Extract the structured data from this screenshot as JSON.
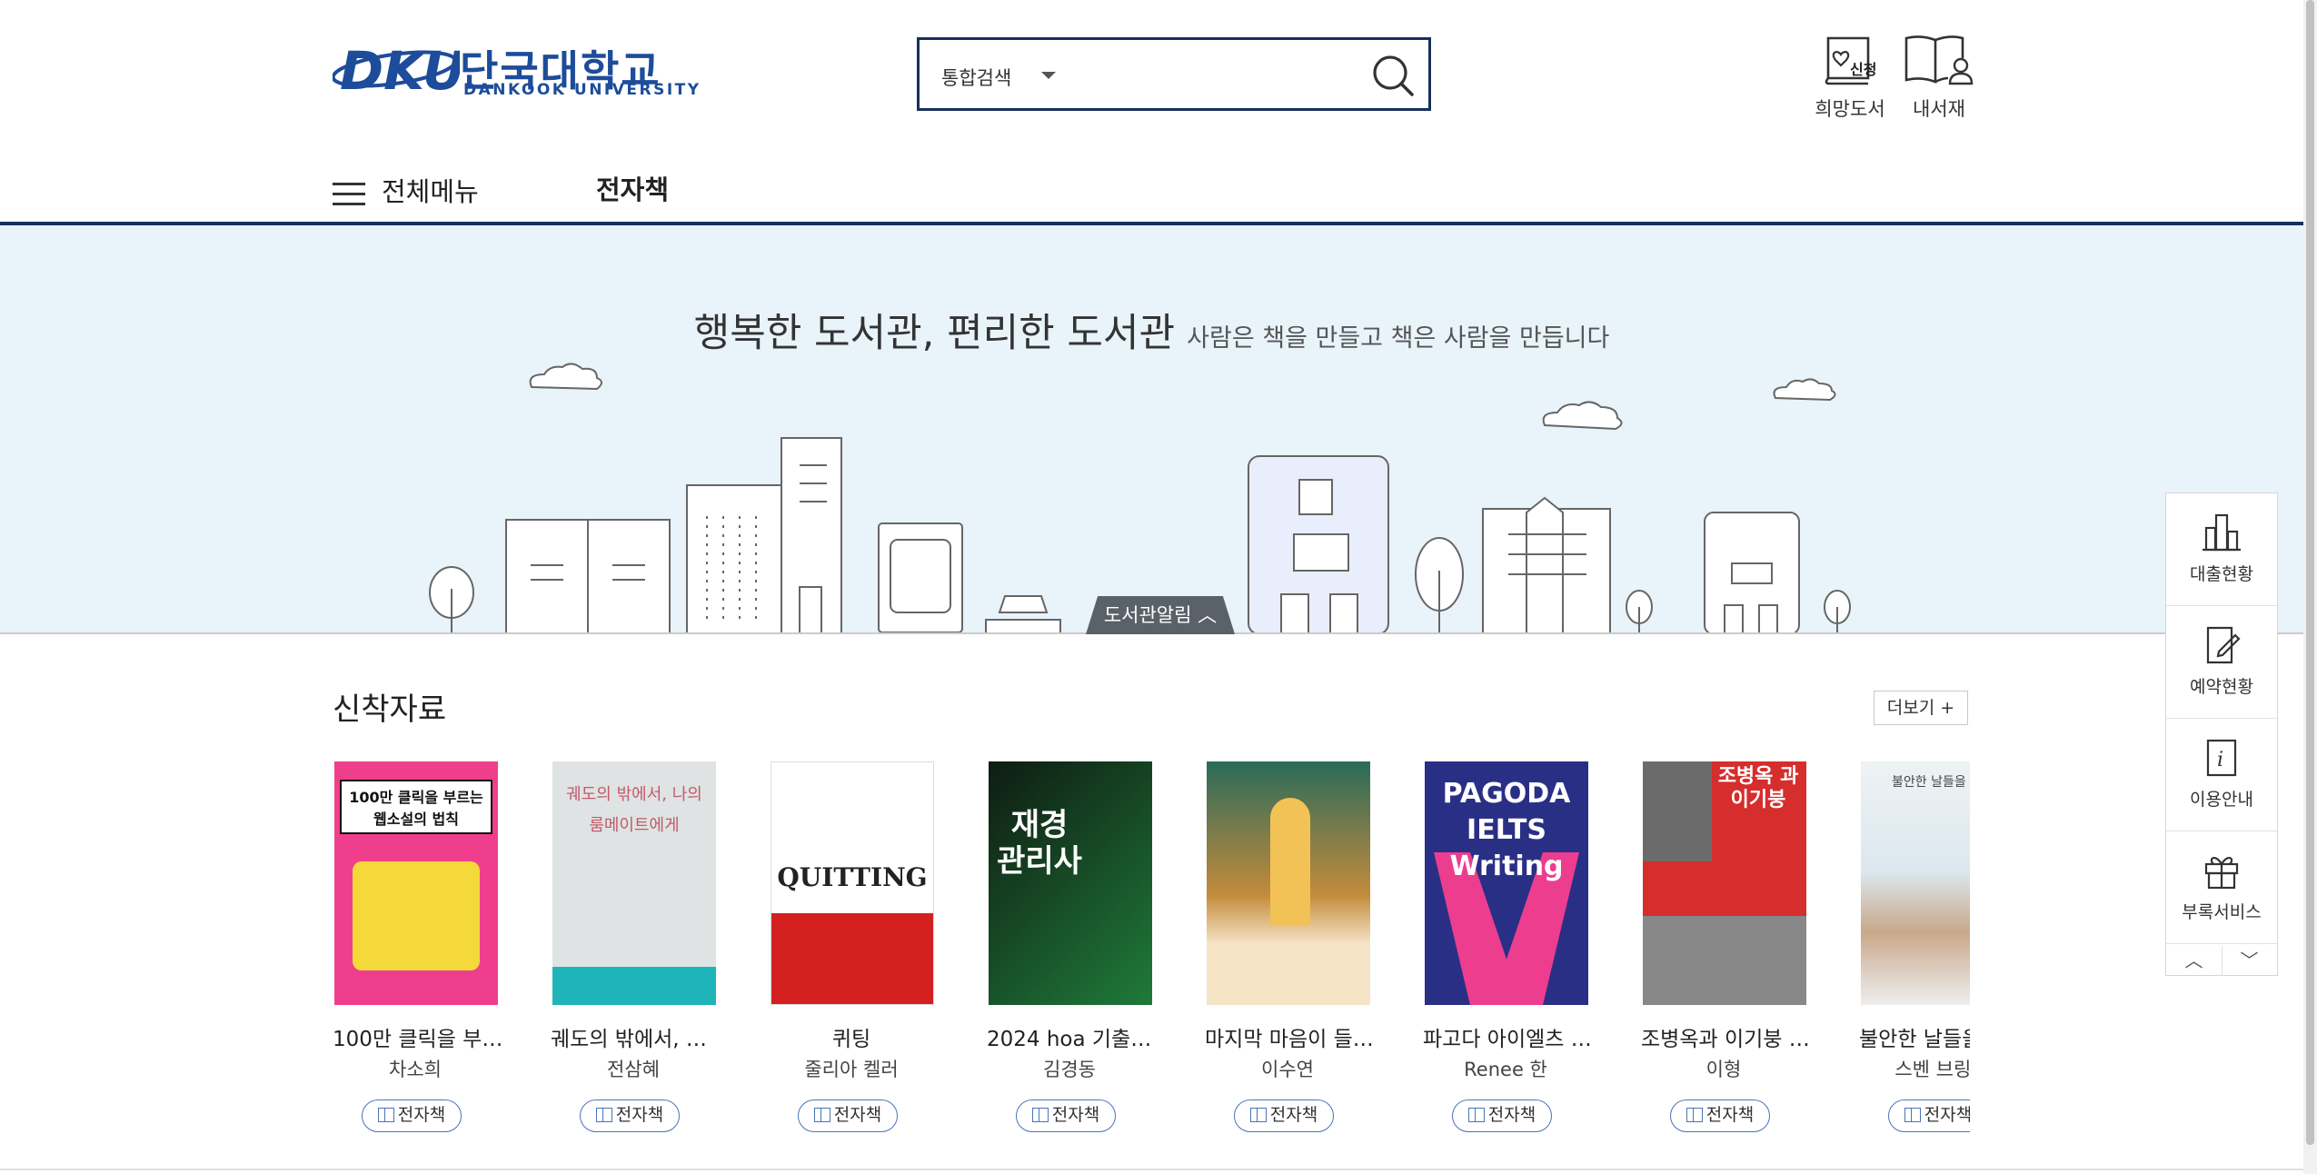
{
  "header": {
    "logo_mark": "DKU",
    "logo_ko": "단국대학교",
    "logo_en": "DANKOOK UNIVERSITY",
    "search": {
      "scope": "통합검색",
      "placeholder": ""
    },
    "wish_book": "희망도서",
    "wish_book_icon_text": "신청",
    "my_shelf": "내서재"
  },
  "gnb": {
    "all_menu": "전체메뉴",
    "ebook": "전자책"
  },
  "hero": {
    "title": "행복한 도서관, 편리한 도서관",
    "subtitle": "사람은 책을 만들고 책은 사람을 만듭니다",
    "notice_tab": "도서관알림"
  },
  "new_arrivals": {
    "title": "신착자료",
    "more": "더보기 +",
    "badge": "전자책",
    "books": [
      {
        "title": "100만 클릭을 부…",
        "author": "차소희",
        "cover_text": "100만 클릭을 부르는 웹소설의 법칙"
      },
      {
        "title": "궤도의 밖에서, …",
        "author": "전삼혜",
        "cover_text": "궤도의 밖에서, 나의 룸메이트에게"
      },
      {
        "title": "퀴팅",
        "author": "줄리아 켈러",
        "cover_text": "QUITTING"
      },
      {
        "title": "2024 hoa 기출…",
        "author": "김경동",
        "cover_text": "재경 관리사"
      },
      {
        "title": "마지막 마음이 들…",
        "author": "이수연",
        "cover_text": ""
      },
      {
        "title": "파고다 아이엘츠 …",
        "author": "Renee 한",
        "cover_text": "PAGODA IELTS Writing"
      },
      {
        "title": "조병옥과 이기붕 …",
        "author": "이형",
        "cover_text": "조병옥 과 이기붕"
      },
      {
        "title": "불안한 날들을…",
        "author": "스벤 브링크",
        "cover_text": "불안한 날들을 위한"
      }
    ]
  },
  "quick_menu": {
    "items": [
      "대출현황",
      "예약현황",
      "이용안내",
      "부록서비스"
    ],
    "up": "︿",
    "down": "﹀"
  }
}
